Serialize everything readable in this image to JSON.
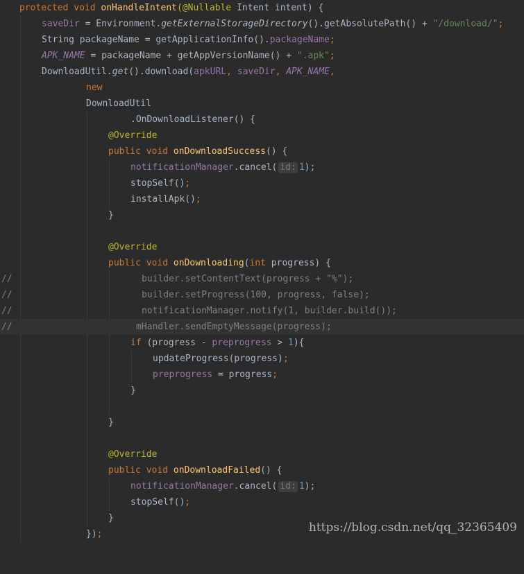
{
  "code": {
    "l1": {
      "kw": "protected void ",
      "fn": "onHandleIntent",
      "ann": "(@Nullable",
      "rest": " Intent intent) {"
    },
    "l2": {
      "field": "saveDir",
      "a": " = Environment.",
      "static": "getExternalStorageDirectory",
      "b": "().getAbsolutePath() + ",
      "str": "\"/download/\"",
      "semi": ";"
    },
    "l3": {
      "a": "String packageName = getApplicationInfo().",
      "field": "packageName",
      "semi": ";"
    },
    "l4": {
      "ifield": "APK_NAME",
      "a": " = packageName + getAppVersionName() + ",
      "str": "\".apk\"",
      "semi": ";"
    },
    "l5": {
      "a": "DownloadUtil.",
      "static": "get",
      "b": "().download(",
      "f1": "apkURL",
      "c1": ", ",
      "f2": "saveDir",
      "c2": ", ",
      "f3": "APK_NAME",
      "c3": ","
    },
    "l6": {
      "kw": "new"
    },
    "l7": {
      "a": "DownloadUtil"
    },
    "l8": {
      "a": ".OnDownloadListener() {"
    },
    "l9": {
      "ann": "@Override"
    },
    "l10": {
      "kw": "public void ",
      "fn": "onDownloadSuccess",
      "rest": "() {"
    },
    "l11": {
      "field": "notificationManager",
      "a": ".cancel(",
      "hint": "id:",
      "num": "1",
      "b": ");"
    },
    "l12": {
      "a": "stopSelf()",
      "semi": ";"
    },
    "l13": {
      "a": "installApk()",
      "semi": ";"
    },
    "l14": {
      "a": "}"
    },
    "l15": {
      "ann": "@Override"
    },
    "l16": {
      "kw": "public void ",
      "fn": "onDownloading",
      "b": "(",
      "kw2": "int",
      "rest": " progress) {"
    },
    "l17": {
      "slash": "//",
      "cmt": "builder.setContentText(progress + \"%\");"
    },
    "l18": {
      "slash": "//",
      "cmt": "builder.setProgress(100, progress, false);"
    },
    "l19": {
      "slash": "//",
      "cmt": "notificationManager.notify(1, builder.build());"
    },
    "l20": {
      "slash": "//",
      "cmt": "mHandler.sendEmptyMessage(progress);"
    },
    "l21": {
      "kw": "if ",
      "a": "(progress - ",
      "field": "preprogress",
      "b": " > ",
      "num": "1",
      "c": "){"
    },
    "l22": {
      "a": "updateProgress(progress)",
      "semi": ";"
    },
    "l23": {
      "field": "preprogress",
      "a": " = progress",
      "semi": ";"
    },
    "l24": {
      "a": "}"
    },
    "l25": {
      "a": "}"
    },
    "l26": {
      "ann": "@Override"
    },
    "l27": {
      "kw": "public void ",
      "fn": "onDownloadFailed",
      "rest": "() {"
    },
    "l28": {
      "field": "notificationManager",
      "a": ".cancel(",
      "hint": "id:",
      "num": "1",
      "b": ");"
    },
    "l29": {
      "a": "stopSelf()",
      "semi": ";"
    },
    "l30": {
      "a": "}"
    },
    "l31": {
      "a": "})",
      "semi": ";"
    }
  },
  "watermark": "https://blog.csdn.net/qq_32365409",
  "colors": {
    "background": "#2b2b2b",
    "text": "#a9b7c6",
    "keyword": "#cc7832",
    "method": "#ffc66d",
    "field": "#9876aa",
    "string": "#6a8759",
    "number": "#6897bb",
    "annotation": "#bbb529",
    "comment": "#808080"
  }
}
